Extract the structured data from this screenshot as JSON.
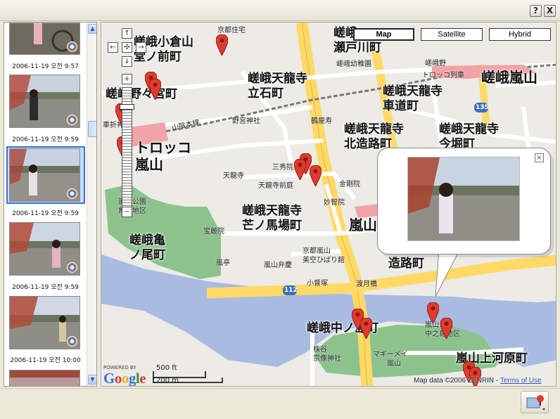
{
  "window": {
    "help_label": "?",
    "close_label": "X"
  },
  "sidebar": {
    "items": [
      {
        "date": "",
        "selected": false
      },
      {
        "date": "2006-11-19 오전 9:57",
        "selected": false
      },
      {
        "date": "2006-11-19 오전 9:59",
        "selected": false
      },
      {
        "date": "2006-11-19 오전 9:59",
        "selected": true
      },
      {
        "date": "2006-11-19 오전 9:59",
        "selected": false
      },
      {
        "date": "2006-11-19 오전 10:00",
        "selected": false
      }
    ],
    "scroll_up": "▲",
    "scroll_down": "▼"
  },
  "map": {
    "types": [
      "Map",
      "Satellite",
      "Hybrid"
    ],
    "active_type": "Map",
    "nav": {
      "up": "↑",
      "left": "←",
      "center": "✣",
      "right": "→",
      "down": "↓",
      "zoom_in": "+",
      "zoom_out": "−"
    },
    "labels_big": [
      "嵯峨小倉山\n堂ノ前町",
      "嵯峨野々宮町",
      "嵯峨天龍寺\n立石町",
      "嵯峨\n瀬戸川町",
      "嵯峨天龍寺\n車道町",
      "嵯峨天龍寺\n北造路町",
      "嵯峨天龍寺\n今堀町",
      "嵯峨天龍寺\n芒ノ馬場町",
      "嵯峨亀\nノ尾町",
      "嵯峨中ノ島町",
      "嵐山上河原町",
      "造路町"
    ],
    "labels_huge": [
      "嵯峨嵐山",
      "トロッコ\n嵐山",
      "嵐山"
    ],
    "labels_small": [
      "京都住宅",
      "嵯峨幼稚園",
      "野宮神社",
      "山陰本線",
      "鶴屋寿",
      "三秀院",
      "天龍寺",
      "天龍寺前庭",
      "金剛院",
      "妙智院",
      "宝厳院",
      "京都嵐山\n美空ひばり館",
      "嵐亭",
      "嵐山弁慶",
      "小督塚",
      "渡月橋",
      "マギーメイ",
      "嵐山公園\n中之島地区",
      "嵐山公園\n亀山地区",
      "株谷\n宗像神社",
      "嵐山",
      "トロッコ列車",
      "嵯峨野",
      "車折神社"
    ],
    "route_badges": [
      "135",
      "112"
    ],
    "scale": {
      "top": "500 ft",
      "bottom": "200 m",
      "powered_by": "POWERED BY",
      "logo": "Google"
    },
    "copyright": "Map data ©2006 ZENRIN -",
    "terms": "Terms of Use",
    "popup": {
      "close": "×"
    }
  },
  "colors": {
    "water": "#a9bbe1",
    "park": "#8cc38c",
    "road": "#ffd966",
    "selected": "#3a6fd6"
  }
}
